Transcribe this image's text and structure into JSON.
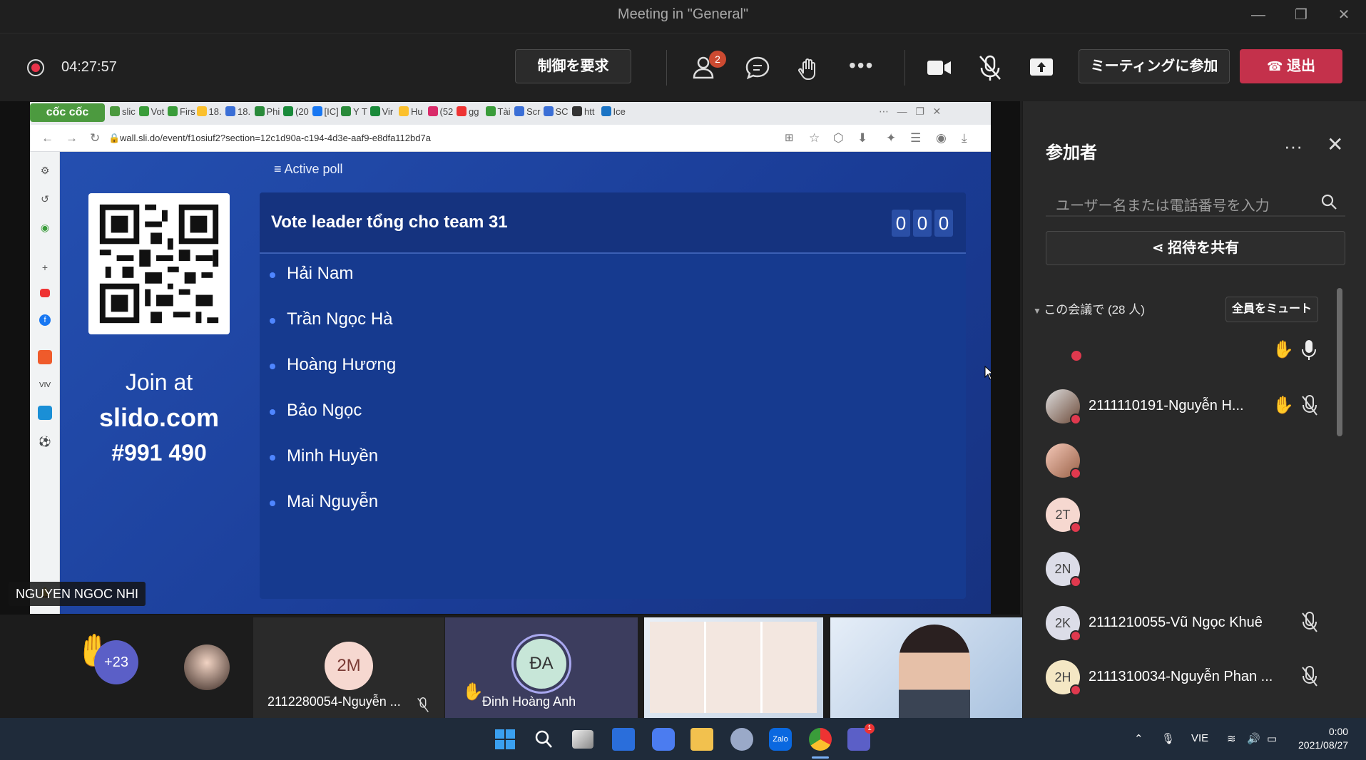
{
  "window": {
    "title": "Meeting in \"General\""
  },
  "toolbar": {
    "timer": "04:27:57",
    "request_control": "制御を要求",
    "people_badge": "2",
    "join_meeting": "ミーティングに参加",
    "leave": "退出"
  },
  "browser": {
    "brand": "cốc cốc",
    "tabs": [
      "slic",
      "Vot",
      "Firs",
      "18.",
      "18.",
      "Phi",
      "(20",
      "[IC]",
      "Y T",
      "Vir",
      "Hu",
      "(52",
      "gg",
      "Tài",
      "Scr",
      "SC",
      "htt",
      "Ice"
    ],
    "url": "wall.sli.do/event/f1osiuf2?section=12c1d90a-c194-4d3e-aaf9-e8dfa112bd7a"
  },
  "slido": {
    "active_poll_label": "Active poll",
    "join_at": "Join at",
    "site": "slido.com",
    "code": "#991 490",
    "question": "Vote leader tổng cho team 31",
    "counter": [
      "0",
      "0",
      "0"
    ],
    "options": [
      "Hải Nam",
      "Trần Ngọc Hà",
      "Hoàng Hương",
      "Bảo Ngọc",
      "Minh Huyền",
      "Mai Nguyễn"
    ]
  },
  "presenter_name": "NGUYEN NGOC NHI",
  "panel": {
    "title": "参加者",
    "search_placeholder": "ユーザー名または電話番号を入力",
    "share_invite": "招待を共有",
    "section": "この会議で (28 人)",
    "mute_all": "全員をミュート",
    "participants": [
      {
        "initials": "",
        "name": ""
      },
      {
        "initials": "",
        "name": "2111110191-Nguyễn H..."
      },
      {
        "initials": "",
        "name": ""
      },
      {
        "initials": "2T",
        "name": ""
      },
      {
        "initials": "2N",
        "name": ""
      },
      {
        "initials": "2K",
        "name": "2111210055-Vũ Ngọc Khuê"
      },
      {
        "initials": "2H",
        "name": "2111310034-Nguyễn Phan ..."
      }
    ]
  },
  "strip": {
    "overflow_count": "+23",
    "tile_2m_initials": "2M",
    "tile_2m_name": "2112280054-Nguyễn ...",
    "tile_da_initials": "ĐA",
    "tile_da_name": "Đinh Hoàng Anh"
  },
  "taskbar": {
    "lang": "VIE",
    "time": "0:00",
    "date": "2021/08/27"
  },
  "colors": {
    "accent": "#8b8cc7",
    "leave": "#c4314b",
    "slido_blue": "#1f45a3"
  }
}
